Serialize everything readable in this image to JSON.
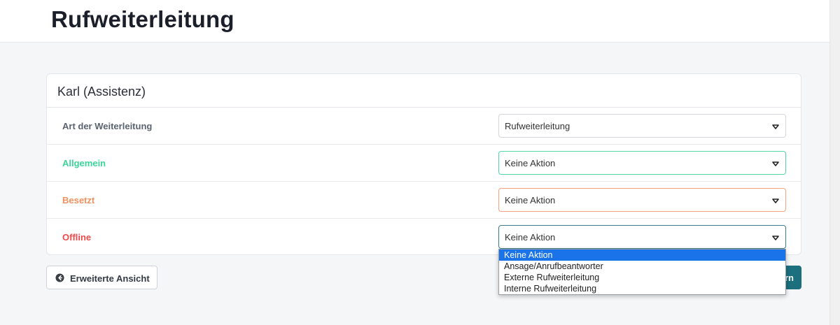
{
  "page": {
    "title": "Rufweiterleitung"
  },
  "card": {
    "title": "Karl (Assistenz)",
    "rows": [
      {
        "label": "Art der Weiterleitung",
        "value": "Rufweiterleitung",
        "color": "#5b6370"
      },
      {
        "label": "Allgemein",
        "value": "Keine Aktion",
        "color": "#3bd598"
      },
      {
        "label": "Besetzt",
        "value": "Keine Aktion",
        "color": "#f0915f"
      },
      {
        "label": "Offline",
        "value": "Keine Aktion",
        "color": "#ec4b4b"
      }
    ]
  },
  "dropdown": {
    "options": [
      "Keine Aktion",
      "Ansage/Anrufbeantworter",
      "Externe Rufweiterleitung",
      "Interne Rufweiterleitung"
    ],
    "selected": "Keine Aktion",
    "highlight_color": "#1a73e8"
  },
  "footer": {
    "advanced_view_label": "Erweiterte Ansicht",
    "advanced_view_icon": "arrow-left-circle-icon",
    "save_label_visible": "rn",
    "save_color": "#1c6f7d"
  }
}
